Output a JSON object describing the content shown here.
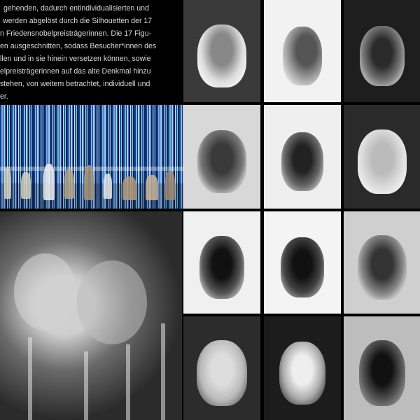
{
  "intro_text": {
    "lines": [
      "gehenden, dadurch entindividualisierten und",
      "werden abgelöst durch die Silhouetten der 17",
      "n Friedensnobelpreisträgerinnen. Die 17 Figu-",
      "en ausgeschnitten, sodass Besucher*innen des",
      "llen und in sie hinein versetzen können, sowie",
      "elpreisträgerinnen auf das alte Denkmal hinzu",
      " stehen, von weitem betrachtet, individuell und",
      "er."
    ]
  },
  "panels": {
    "stripes_panel": "colored vertical stripes with small figure silhouettes",
    "large_photo": "inverted photograph of two figures"
  },
  "portraits": [
    "inverted portrait 1",
    "inverted portrait 2",
    "inverted portrait 3",
    "inverted portrait 4",
    "inverted portrait 5",
    "inverted portrait 6",
    "inverted portrait 7",
    "inverted portrait 8",
    "inverted portrait 9",
    "inverted portrait 10",
    "inverted portrait 11",
    "inverted portrait 12"
  ]
}
